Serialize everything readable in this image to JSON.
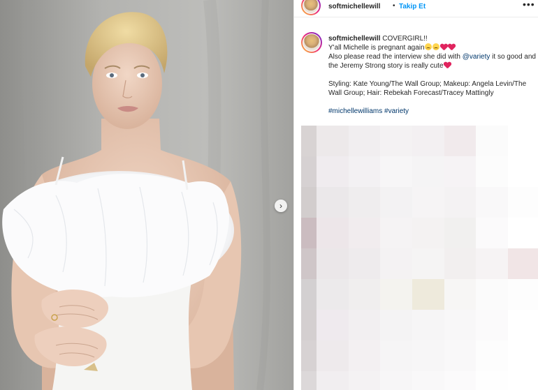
{
  "post": {
    "username": "softmichellewill",
    "separator": "•",
    "follow_label": "Takip Et",
    "more_label": "•••",
    "next_arrow": "›"
  },
  "caption": {
    "username": "softmichellewill",
    "line1_text": "COVERGIRL!!",
    "line2_text": "Y'all Michelle is pregnant again",
    "line3_prefix": "Also please read the interview she did with ",
    "line3_mention": "@variety",
    "line3_suffix": " it so good and",
    "line4_text": "the Jeremy Strong story is really cute",
    "credits_line1": "Styling: Kate Young/The Wall Group; Makeup: Angela Levin/The",
    "credits_line2": "Wall Group; Hair: Rebekah Forecast/Tracey Mattingly",
    "hashtag1": "#michellewilliams",
    "hashtag2": "#variety"
  },
  "icons": {
    "sad_emoji": "crying-face",
    "heart_emoji": "red-heart",
    "next": "chevron-right-icon",
    "more": "more-options-icon"
  },
  "colors": {
    "link": "#00376b",
    "follow": "#0095f6",
    "heart": "#e0245e",
    "text": "#262626"
  }
}
